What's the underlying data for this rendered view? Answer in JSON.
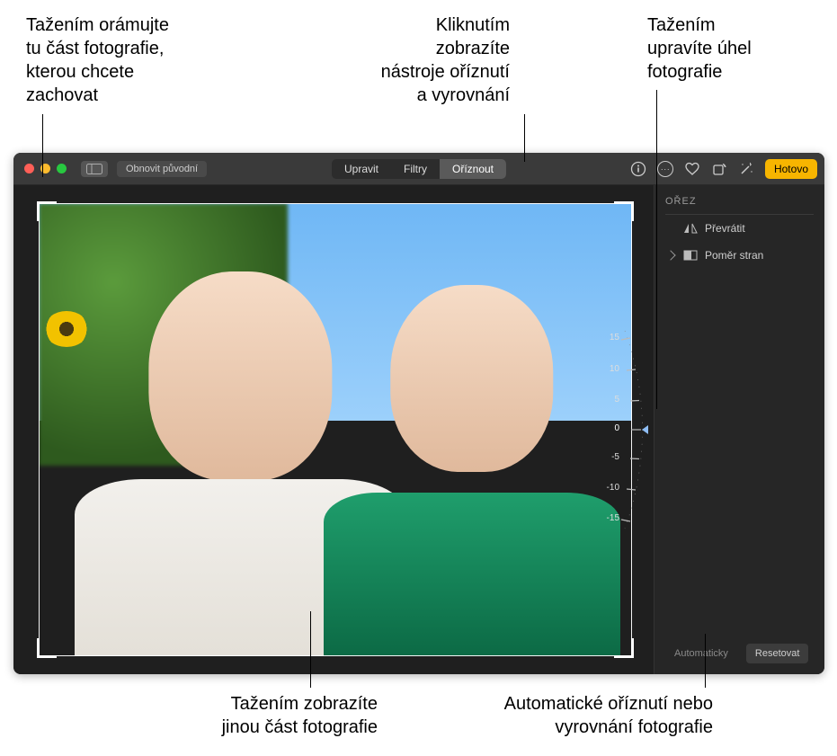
{
  "callouts": {
    "frame": "Tažením orámujte\ntu část fotografie,\nkterou chcete\nzachovat",
    "crop_tools": "Kliknutím\nzobrazíte\nnástroje oříznutí\na vyrovnání",
    "angle": "Tažením\nupravíte úhel\nfotografie",
    "pan": "Tažením zobrazíte\njinou část fotografie",
    "auto": "Automatické oříznutí nebo\nvyrovnání fotografie"
  },
  "toolbar": {
    "revert": "Obnovit původní",
    "tabs": {
      "adjust": "Upravit",
      "filters": "Filtry",
      "crop": "Oříznout"
    },
    "done": "Hotovo"
  },
  "sidebar": {
    "title": "OŘEZ",
    "flip": "Převrátit",
    "aspect": "Poměr stran"
  },
  "angle_ticks": {
    "p15": "15",
    "p10": "10",
    "p5": "5",
    "zero": "0",
    "m5": "-5",
    "m10": "-10",
    "m15": "-15"
  },
  "footer": {
    "auto": "Automaticky",
    "reset": "Resetovat"
  }
}
